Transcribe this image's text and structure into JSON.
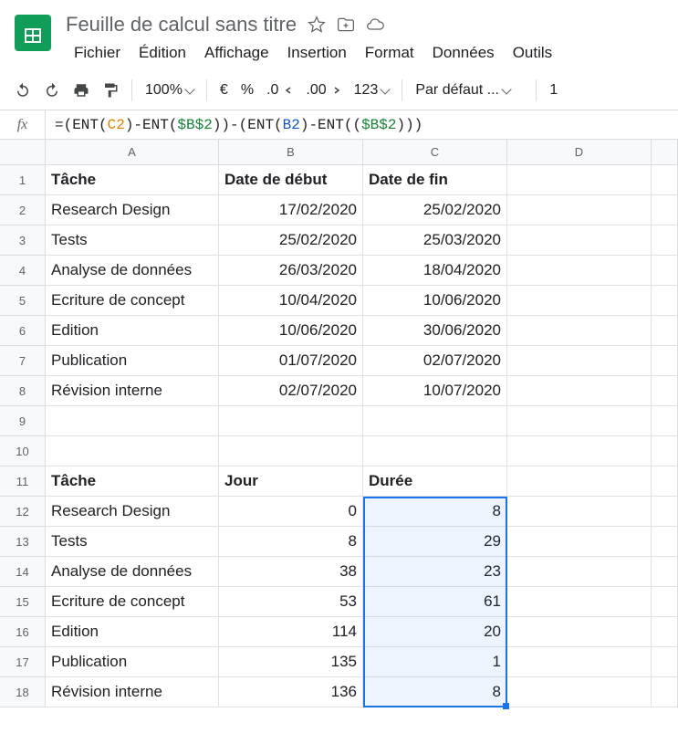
{
  "doc_title": "Feuille de calcul sans titre",
  "menus": [
    "Fichier",
    "Édition",
    "Affichage",
    "Insertion",
    "Format",
    "Données",
    "Outils"
  ],
  "toolbar": {
    "zoom": "100%",
    "currency": "€",
    "percent": "%",
    "dec_dec": ".0",
    "dec_inc": ".00",
    "numfmt": "123",
    "font": "Par défaut ...",
    "size_partial": "1"
  },
  "formula": {
    "prefix": "=(ENT(",
    "c2": "C2",
    "m1": ")-ENT(",
    "b2a": "$B$2",
    "m2": "))-(ENT(",
    "b2": "B2",
    "m3": ")-ENT((",
    "b2b": "$B$2",
    "suffix": ")))"
  },
  "columns": [
    "A",
    "B",
    "C",
    "D"
  ],
  "row_count": 18,
  "cells": {
    "A1": "Tâche",
    "B1": "Date de début",
    "C1": "Date de fin",
    "A2": "Research Design",
    "B2": "17/02/2020",
    "C2": "25/02/2020",
    "A3": "Tests",
    "B3": "25/02/2020",
    "C3": "25/03/2020",
    "A4": "Analyse de données",
    "B4": "26/03/2020",
    "C4": "18/04/2020",
    "A5": "Ecriture de concept",
    "B5": "10/04/2020",
    "C5": "10/06/2020",
    "A6": "Edition",
    "B6": "10/06/2020",
    "C6": "30/06/2020",
    "A7": "Publication",
    "B7": "01/07/2020",
    "C7": "02/07/2020",
    "A8": "Révision interne",
    "B8": "02/07/2020",
    "C8": "10/07/2020",
    "A11": "Tâche",
    "B11": "Jour",
    "C11": "Durée",
    "A12": "Research Design",
    "B12": "0",
    "C12": "8",
    "A13": "Tests",
    "B13": "8",
    "C13": "29",
    "A14": "Analyse de données",
    "B14": "38",
    "C14": "23",
    "A15": "Ecriture de concept",
    "B15": "53",
    "C15": "61",
    "A16": "Edition",
    "B16": "114",
    "C16": "20",
    "A17": "Publication",
    "B17": "135",
    "C17": "1",
    "A18": "Révision interne",
    "B18": "136",
    "C18": "8"
  },
  "bold_rows": [
    1,
    11
  ],
  "right_align_cols_rows": {
    "B": [
      2,
      3,
      4,
      5,
      6,
      7,
      8,
      12,
      13,
      14,
      15,
      16,
      17,
      18
    ],
    "C": [
      2,
      3,
      4,
      5,
      6,
      7,
      8,
      12,
      13,
      14,
      15,
      16,
      17,
      18
    ]
  },
  "selection": {
    "col": "C",
    "rows": [
      12,
      18
    ]
  }
}
